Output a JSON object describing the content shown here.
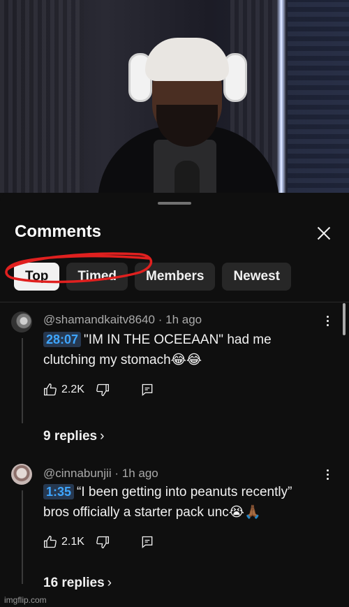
{
  "panel": {
    "title": "Comments",
    "close_icon": "close-icon",
    "filters": [
      "Top",
      "Timed",
      "Members",
      "Newest"
    ],
    "active_filter": "Top"
  },
  "comments": [
    {
      "author": "@shamandkaitv8640",
      "separator": "·",
      "age": "1h ago",
      "timestamp": "28:07",
      "text_line1": "\"IM IN THE OCEEAAN\" had me",
      "text_line2": "clutching my stomach😂😂",
      "likes": "2.2K",
      "replies": "9 replies"
    },
    {
      "author": "@cinnabunjii",
      "separator": "·",
      "age": "1h ago",
      "timestamp": "1:35",
      "text_line1": "“I been getting into peanuts  recently”",
      "text_line2": "bros officially a starter pack unc😭🙏🏾",
      "likes": "2.1K",
      "replies": "16 replies"
    }
  ],
  "icons": {
    "like": "thumbs-up-icon",
    "dislike": "thumbs-down-icon",
    "reply": "reply-icon",
    "more": "more-vert-icon",
    "chevron": "chevron-right-icon"
  },
  "annotation_color": "#e0201f",
  "watermark": "imgflip.com"
}
